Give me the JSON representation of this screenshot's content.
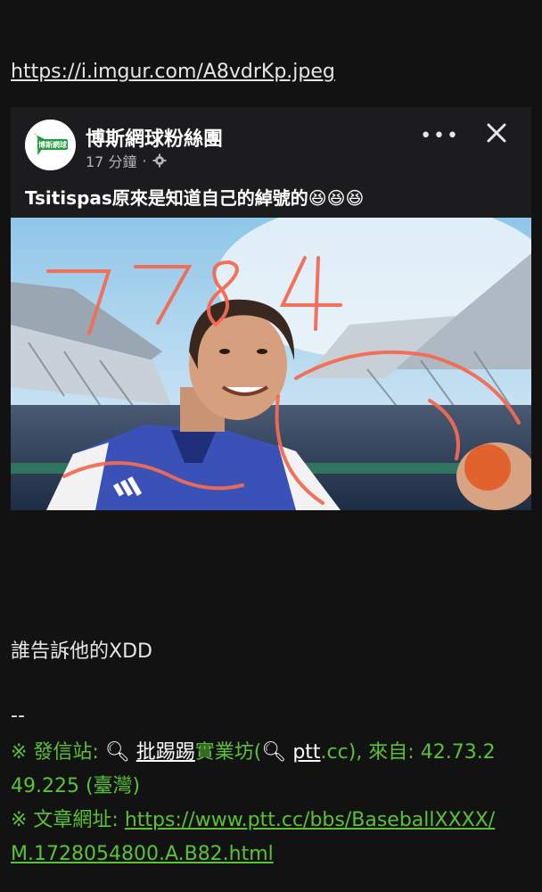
{
  "top_link": "https://i.imgur.com/A8vdrKp.jpeg",
  "fb_post": {
    "avatar_text": "博斯網球",
    "page_name": "博斯網球粉絲團",
    "time": "17 分鐘",
    "dot": "·",
    "more": "•••",
    "caption": "Tsitispas原來是知道自己的綽號的😆😆😆",
    "photo_handwriting": "7784"
  },
  "body_text": "誰告訴他的XDD",
  "separator": "--",
  "signature": {
    "prefix1": "※ 發信站: ",
    "search1": "批踢踢",
    "mid1": "實業坊(",
    "search2": "ptt",
    "rest1": ".cc), 來自: 42.73.2",
    "line2": "49.225 (臺灣)",
    "prefix2": "※ 文章網址: ",
    "url_part1": "https://www.ptt.cc/bbs/BaseballXXXX/",
    "url_part2": "M.1728054800.A.B82.html"
  },
  "colors": {
    "background": "#121212",
    "signature": "#5bc236",
    "card": "#1c1c1e"
  }
}
